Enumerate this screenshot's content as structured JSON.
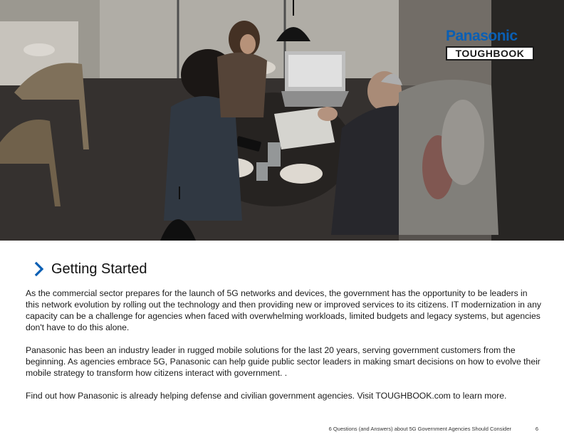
{
  "brand": {
    "name": "Panasonic",
    "product": "TOUGHBOOK"
  },
  "section": {
    "heading": "Getting Started",
    "paragraphs": [
      "As the commercial sector prepares for the launch of 5G networks and devices, the government has the opportunity to be leaders in this network evolution by rolling out the technology and then providing new or improved services to its citizens. IT modernization in any capacity can be a challenge for agencies when faced with overwhelming workloads, limited budgets and legacy systems, but agencies don't have to do this alone.",
      "Panasonic has been an industry leader in rugged mobile solutions for the last 20 years, serving government customers from the beginning. As agencies embrace 5G, Panasonic can help guide public sector leaders in making smart decisions on how to evolve their mobile strategy to transform how citizens interact with government. .",
      "Find out how Panasonic is already helping defense and civilian government agencies. Visit TOUGHBOOK.com to learn more."
    ]
  },
  "footer": {
    "document_title": "6 Questions (and Answers) about 5G Government Agencies Should Consider",
    "page_number": "6"
  },
  "colors": {
    "brand_blue": "#0a5fb4",
    "chevron": "#0a5fb4"
  },
  "icons": {
    "heading_marker": "chevron-right-icon"
  }
}
